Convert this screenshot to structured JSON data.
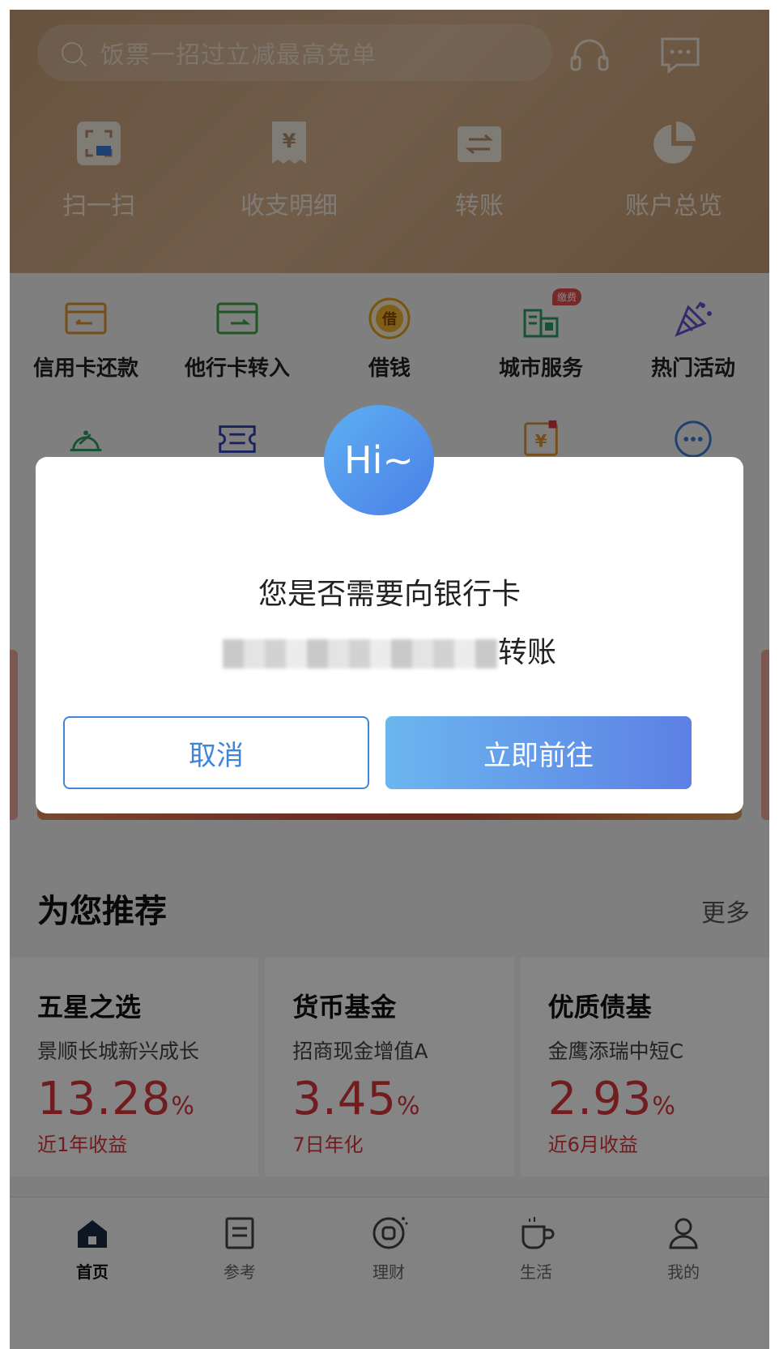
{
  "header": {
    "search_placeholder": "饭票一招过立减最高免单",
    "icons": [
      "headset-icon",
      "message-icon"
    ],
    "quick_actions": [
      {
        "label": "扫一扫",
        "icon": "scan-icon"
      },
      {
        "label": "收支明细",
        "icon": "receipt-icon"
      },
      {
        "label": "转账",
        "icon": "transfer-icon"
      },
      {
        "label": "账户总览",
        "icon": "pie-chart-icon"
      }
    ]
  },
  "services": [
    {
      "label": "信用卡还款",
      "icon": "card-repay-icon"
    },
    {
      "label": "他行卡转入",
      "icon": "card-transfer-in-icon"
    },
    {
      "label": "借钱",
      "icon": "borrow-icon"
    },
    {
      "label": "城市服务",
      "icon": "city-icon",
      "badge": "缴费"
    },
    {
      "label": "热门活动",
      "icon": "party-icon"
    }
  ],
  "services_row2_icons": [
    "service-bell-icon",
    "ticket-icon",
    "",
    "yuan-doc-icon",
    "more-icon"
  ],
  "recommend": {
    "title": "为您推荐",
    "more": "更多",
    "cards": [
      {
        "title": "五星之选",
        "fund": "景顺长城新兴成长",
        "value": "13.28",
        "unit": "%",
        "label": "近1年收益"
      },
      {
        "title": "货币基金",
        "fund": "招商现金增值A",
        "value": "3.45",
        "unit": "%",
        "label": "7日年化"
      },
      {
        "title": "优质债基",
        "fund": "金鹰添瑞中短C",
        "value": "2.93",
        "unit": "%",
        "label": "近6月收益"
      }
    ]
  },
  "tabs": [
    {
      "label": "首页",
      "icon": "home-icon",
      "active": true
    },
    {
      "label": "参考",
      "icon": "news-icon",
      "active": false
    },
    {
      "label": "理财",
      "icon": "wealth-icon",
      "active": false
    },
    {
      "label": "生活",
      "icon": "coffee-icon",
      "active": false
    },
    {
      "label": "我的",
      "icon": "user-icon",
      "active": false
    }
  ],
  "modal": {
    "avatar_text": "Hi~",
    "line1": "您是否需要向银行卡",
    "line2_suffix": "转账",
    "cancel": "取消",
    "confirm": "立即前往"
  },
  "colors": {
    "header_gold": "#c9a07a",
    "accent_blue": "#3f86d9",
    "value_red": "#d8373b"
  }
}
